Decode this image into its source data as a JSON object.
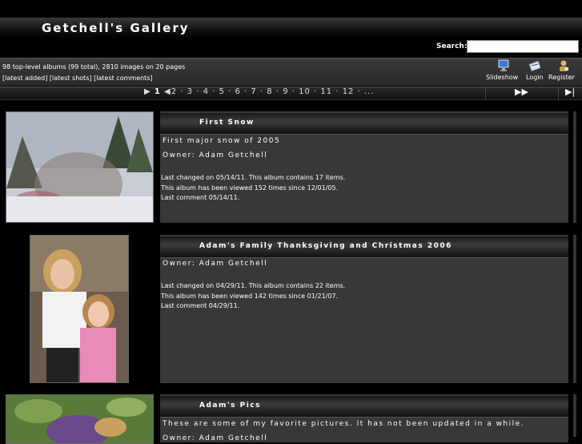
{
  "header": {
    "title": "Getchell's Gallery"
  },
  "search": {
    "label": "Search:",
    "value": "",
    "placeholder": ""
  },
  "stats": {
    "summary": "98 top-level albums (99 total), 2810 images on 20 pages",
    "links": [
      "[latest added]",
      "[latest shots]",
      "[latest comments]"
    ]
  },
  "toolbar": {
    "slideshow": "Slideshow",
    "login": "Login",
    "register": "Register"
  },
  "pager": {
    "current": "1",
    "pages": [
      "2",
      "3",
      "4",
      "5",
      "6",
      "7",
      "8",
      "9",
      "10",
      "11",
      "12"
    ],
    "ellipsis": "..."
  },
  "albums": [
    {
      "title": "First Snow",
      "description": "First major snow of 2005",
      "owner": "Owner: Adam Getchell",
      "changed": "Last changed on 05/14/11. This album contains 17 items.",
      "views": "This album has been viewed 152 times since 12/01/05.",
      "comment": "Last comment 05/14/11."
    },
    {
      "title": "Adam's Family Thanksgiving and Christmas 2006",
      "owner": "Owner: Adam Getchell",
      "changed": "Last changed on 04/29/11. This album contains 22 items.",
      "views": "This album has been viewed 142 times since 01/21/07.",
      "comment": "Last comment 04/29/11."
    },
    {
      "title": "Adam's Pics",
      "description": "These are some of my favorite pictures. It has not been updated in a while.",
      "owner": "Owner: Adam Getchell"
    }
  ],
  "colors": {
    "background": "#000000",
    "panel": "#383838",
    "accent": "#ffffff"
  }
}
